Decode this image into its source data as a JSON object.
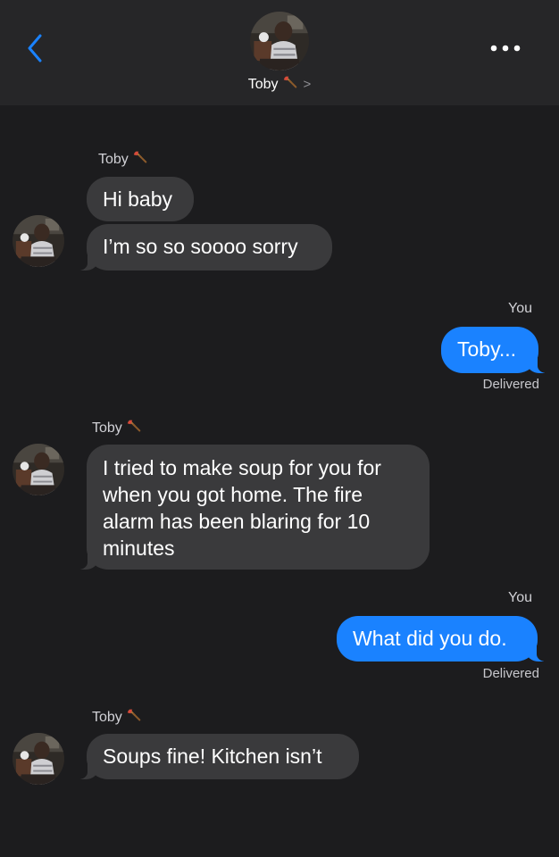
{
  "header": {
    "contact_name": "Toby",
    "chevron": ">",
    "back_icon": "chevron-left-icon",
    "more_icon": "more-dots-icon",
    "emoji_icon": "axe-icon"
  },
  "colors": {
    "accent": "#1a82ff",
    "incoming_bubble": "#3a3a3c",
    "background": "#1c1c1e",
    "header_background": "#262628"
  },
  "messages": [
    {
      "side": "in",
      "sender": "Toby",
      "texts": [
        "Hi baby",
        "I’m so so soooo sorry"
      ]
    },
    {
      "side": "out",
      "sender": "You",
      "text": "Toby...",
      "status": "Delivered"
    },
    {
      "side": "in",
      "sender": "Toby",
      "lines": [
        "I tried to make soup for you for",
        "when you got home. The fire",
        "alarm has been blaring for 10",
        "minutes"
      ]
    },
    {
      "side": "out",
      "sender": "You",
      "text": "What did you do.",
      "status": "Delivered"
    },
    {
      "side": "in",
      "sender": "Toby",
      "texts": [
        "Soups fine! Kitchen isn’t"
      ]
    }
  ]
}
